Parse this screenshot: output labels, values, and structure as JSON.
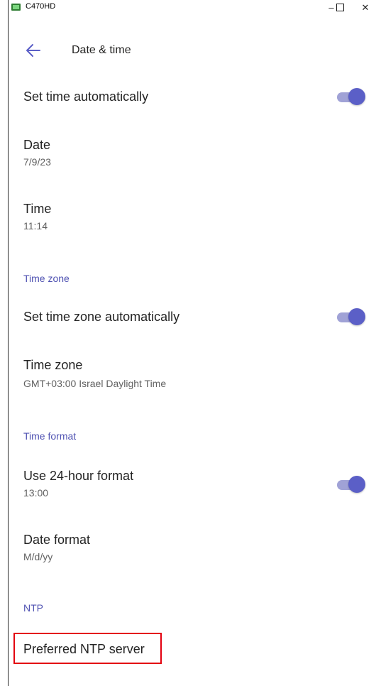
{
  "window": {
    "title": "C470HD",
    "minimize_glyph": "–",
    "close_glyph": "✕"
  },
  "header": {
    "back_icon": "arrow-left-icon",
    "title": "Date & time"
  },
  "colors": {
    "accent": "#5b5fc7",
    "section": "#4f52b2",
    "highlight": "#e3000f"
  },
  "rows": {
    "set_time_auto": {
      "title": "Set time automatically",
      "toggle_on": true
    },
    "date": {
      "title": "Date",
      "value": "7/9/23"
    },
    "time": {
      "title": "Time",
      "value": "11:14"
    },
    "time_zone_section": "Time zone",
    "set_tz_auto": {
      "title": "Set time zone automatically",
      "toggle_on": true
    },
    "time_zone": {
      "title": "Time zone",
      "value": "GMT+03:00 Israel Daylight Time"
    },
    "time_format_section": "Time format",
    "use_24h": {
      "title": "Use 24-hour format",
      "value": "13:00",
      "toggle_on": true
    },
    "date_format": {
      "title": "Date format",
      "value": "M/d/yy"
    },
    "ntp_section": "NTP",
    "preferred_ntp": {
      "title": "Preferred NTP server"
    }
  }
}
